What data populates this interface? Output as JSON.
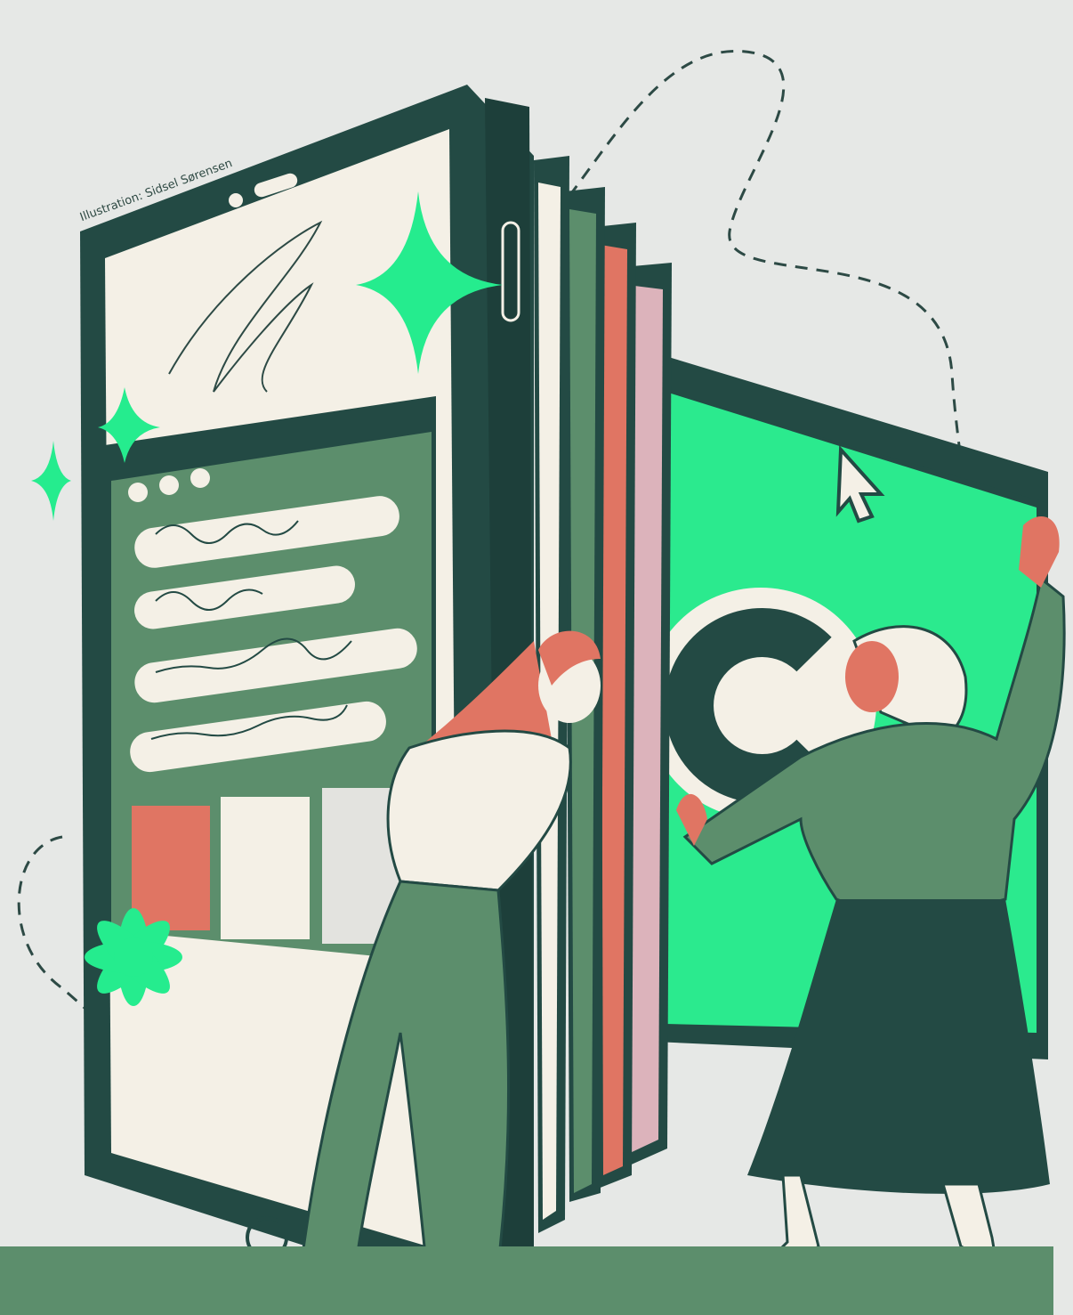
{
  "credit": "Illustration: Sidsel Sørensen",
  "colors": {
    "background": "#e6e8e6",
    "dark_teal": "#234a44",
    "mint": "#25ec8e",
    "sage": "#5c8e6c",
    "coral": "#e07563",
    "cream": "#f4f0e6",
    "pink": "#dcb3bb",
    "footer": "#5c8e6c"
  },
  "icons": {
    "copyright": "copyright-icon",
    "cursor": "mouse-cursor-icon",
    "sparkle": "sparkle-icon",
    "flower": "flower-icon"
  }
}
